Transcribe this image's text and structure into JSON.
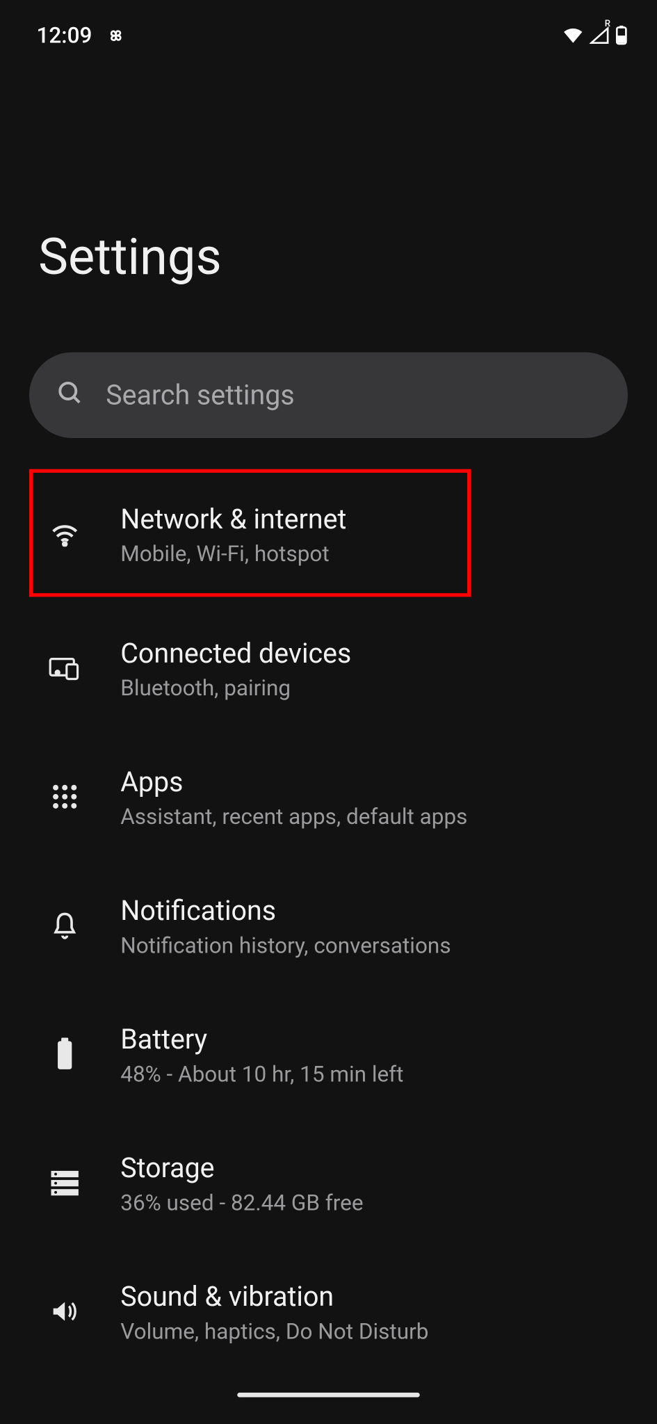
{
  "statusbar": {
    "time": "12:09"
  },
  "header": {
    "title": "Settings"
  },
  "search": {
    "placeholder": "Search settings"
  },
  "items": [
    {
      "title": "Network & internet",
      "sub": "Mobile, Wi-Fi, hotspot"
    },
    {
      "title": "Connected devices",
      "sub": "Bluetooth, pairing"
    },
    {
      "title": "Apps",
      "sub": "Assistant, recent apps, default apps"
    },
    {
      "title": "Notifications",
      "sub": "Notification history, conversations"
    },
    {
      "title": "Battery",
      "sub": "48% - About 10 hr, 15 min left"
    },
    {
      "title": "Storage",
      "sub": "36% used - 82.44 GB free"
    },
    {
      "title": "Sound & vibration",
      "sub": "Volume, haptics, Do Not Disturb"
    }
  ]
}
